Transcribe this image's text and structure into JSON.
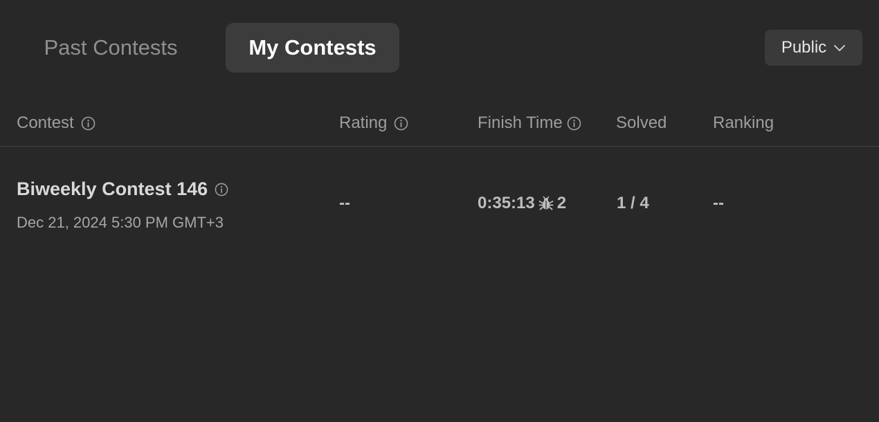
{
  "tabs": {
    "past_label": "Past Contests",
    "mine_label": "My Contests"
  },
  "filter": {
    "selected": "Public",
    "icon": "chevron-down-icon"
  },
  "table": {
    "headers": {
      "contest": "Contest",
      "rating": "Rating",
      "finish_time": "Finish Time",
      "solved": "Solved",
      "ranking": "Ranking"
    },
    "rows": [
      {
        "contest_name": "Biweekly Contest 146",
        "date": "Dec 21, 2024 5:30 PM GMT+3",
        "rating": "--",
        "finish_time": "0:35:13",
        "bug_count": "2",
        "solved": "1 / 4",
        "ranking": "--"
      }
    ]
  },
  "colors": {
    "background": "#282828",
    "active_tab": "#3c3c3c",
    "dropdown": "#3a3a3a"
  }
}
